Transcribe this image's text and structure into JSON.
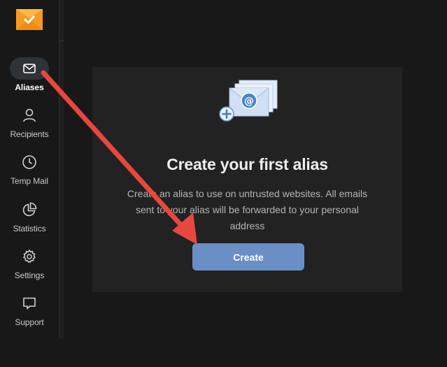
{
  "sidebar": {
    "items": [
      {
        "label": "Aliases",
        "icon": "mail-icon",
        "active": true
      },
      {
        "label": "Recipients",
        "icon": "user-icon",
        "active": false
      },
      {
        "label": "Temp Mail",
        "icon": "clock-icon",
        "active": false
      },
      {
        "label": "Statistics",
        "icon": "pie-chart-icon",
        "active": false
      },
      {
        "label": "Settings",
        "icon": "gear-icon",
        "active": false
      },
      {
        "label": "Support",
        "icon": "chat-bubble-icon",
        "active": false
      }
    ]
  },
  "main": {
    "empty_state": {
      "title": "Create your first alias",
      "description": "Create an alias to use on untrusted websites. All emails sent to your alias will be forwarded to your personal address",
      "button_label": "Create",
      "illustration": "envelope-at-add-icon"
    }
  },
  "colors": {
    "background": "#181818",
    "card": "#222222",
    "accent": "#6a8fc6",
    "logo": "#f7a531",
    "annotation_arrow": "#e8473f"
  }
}
